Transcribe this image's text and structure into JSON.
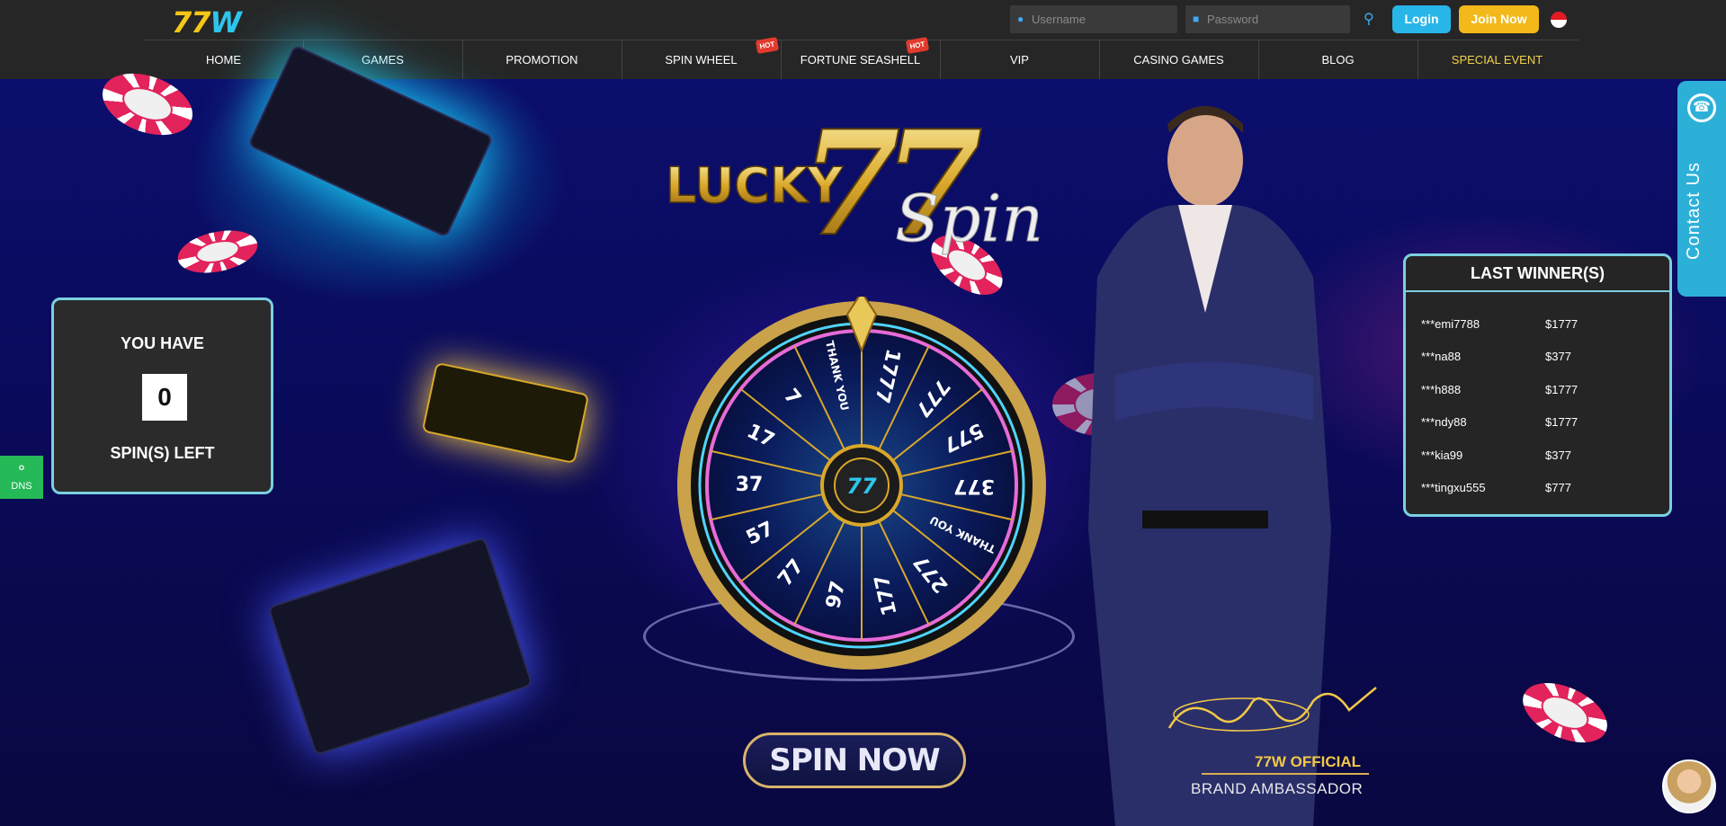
{
  "header": {
    "logo_part1": "77",
    "logo_part2": "W",
    "username_placeholder": "Username",
    "password_placeholder": "Password",
    "login_label": "Login",
    "join_label": "Join Now",
    "nav": [
      {
        "label": "HOME"
      },
      {
        "label": "GAMES"
      },
      {
        "label": "PROMOTION"
      },
      {
        "label": "SPIN WHEEL",
        "badge": "HOT"
      },
      {
        "label": "FORTUNE SEASHELL",
        "badge": "HOT"
      },
      {
        "label": "VIP"
      },
      {
        "label": "CASINO GAMES"
      },
      {
        "label": "BLOG"
      },
      {
        "label": "SPECIAL EVENT"
      }
    ]
  },
  "hero": {
    "title_word1": "LUCKY",
    "title_number": "77",
    "title_word2": "Spin",
    "wheel_segments": [
      "1777",
      "777",
      "577",
      "377",
      "THANK YOU",
      "277",
      "177",
      "97",
      "77",
      "57",
      "37",
      "17",
      "7",
      "THANK YOU"
    ],
    "wheel_center_label": "77",
    "spin_button": "SPIN NOW"
  },
  "spins": {
    "label_top": "YOU HAVE",
    "count": "0",
    "label_bottom": "SPIN(S) LEFT"
  },
  "winners": {
    "title": "LAST WINNER(S)",
    "rows": [
      {
        "name": "***emi7788",
        "amount": "$1777"
      },
      {
        "name": "***na88",
        "amount": "$377"
      },
      {
        "name": "***h888",
        "amount": "$1777"
      },
      {
        "name": "***ndy88",
        "amount": "$1777"
      },
      {
        "name": "***kia99",
        "amount": "$377"
      },
      {
        "name": "***tingxu555",
        "amount": "$777"
      }
    ]
  },
  "contact": {
    "label": "Contact Us"
  },
  "dns": {
    "label": "DNS"
  },
  "ambassador": {
    "line1": "77W OFFICIAL",
    "line2": "BRAND AMBASSADOR"
  },
  "colors": {
    "accent_blue": "#28b6e8",
    "accent_gold": "#f3b819",
    "panel_border": "#7ad0e0",
    "dns_green": "#26b957"
  }
}
